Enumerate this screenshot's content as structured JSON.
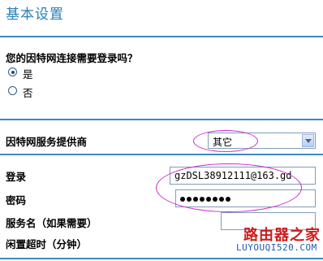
{
  "header": {
    "title": "基本设置"
  },
  "login_required": {
    "question": "您的因特网连接需要登录吗？",
    "options": [
      {
        "label": "是",
        "checked": true
      },
      {
        "label": "否",
        "checked": false
      }
    ]
  },
  "isp": {
    "label": "因特网服务提供商",
    "selected": "其它"
  },
  "credentials": {
    "login_label": "登录",
    "login_value": "gzDSL38912111@163.gd",
    "password_label": "密码",
    "password_dots": 8,
    "service_label": "服务名（如果需要）",
    "service_value": "",
    "idle_label": "闲置超时（分钟）"
  },
  "watermark": {
    "text": "路由器之家",
    "sub": "LUYOUQI520.COM"
  },
  "colors": {
    "accent": "#2a7fb8",
    "rule": "#3a8ac7",
    "annotation": "#d028d0"
  }
}
